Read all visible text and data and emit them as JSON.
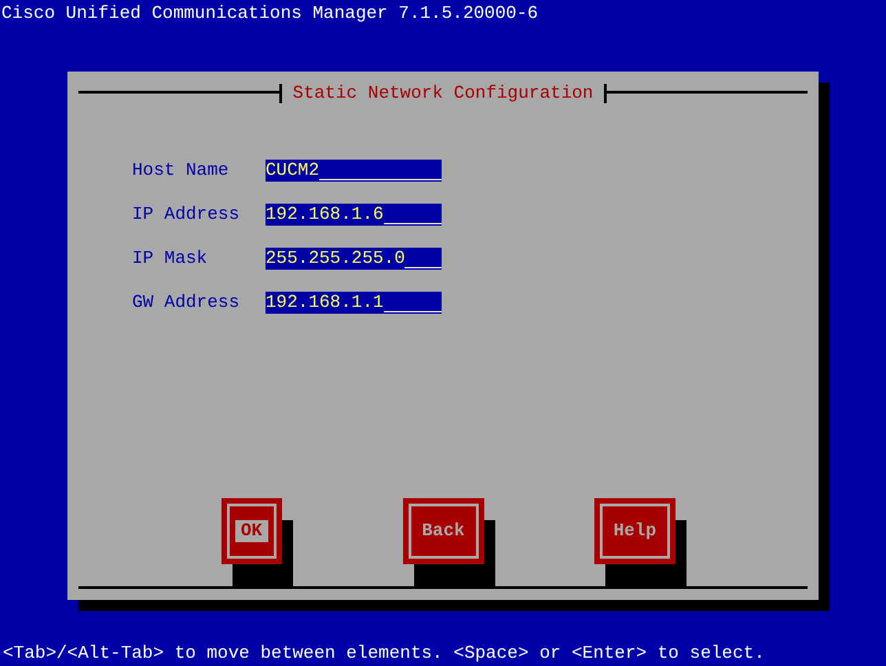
{
  "title": "Cisco Unified Communications Manager 7.1.5.20000-6",
  "dialog": {
    "title": "Static Network Configuration",
    "fields": [
      {
        "label": "Host Name",
        "value": "CUCM2"
      },
      {
        "label": "IP Address",
        "value": "192.168.1.6"
      },
      {
        "label": "IP Mask",
        "value": "255.255.255.0"
      },
      {
        "label": "GW Address",
        "value": "192.168.1.1"
      }
    ],
    "buttons": [
      {
        "label": "OK",
        "selected": true
      },
      {
        "label": "Back",
        "selected": false
      },
      {
        "label": "Help",
        "selected": false
      }
    ]
  },
  "status_bar": "<Tab>/<Alt-Tab> to move between elements. <Space> or <Enter> to select."
}
